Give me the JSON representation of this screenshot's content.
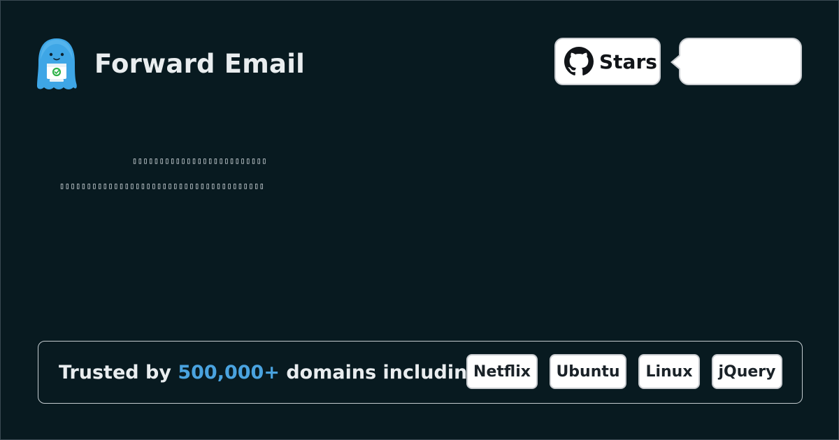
{
  "brand": {
    "name": "Forward Email",
    "logo_icon": "mascot-icon"
  },
  "github": {
    "icon": "github-icon",
    "label": "Stars",
    "count": ""
  },
  "placeholder_lines": [
    "▯▯▯▯▯▯▯▯▯▯▯▯▯▯▯▯▯▯▯▯▯▯▯▯▯",
    "▯▯▯▯▯▯▯▯▯▯▯▯▯▯▯▯▯▯▯▯▯▯▯▯▯▯▯▯▯▯▯▯▯▯▯▯▯▯"
  ],
  "trusted": {
    "prefix": "Trusted by",
    "count": "500,000+",
    "suffix": "domains including:",
    "domains": [
      "Netflix",
      "Ubuntu",
      "Linux",
      "jQuery"
    ]
  },
  "colors": {
    "background": "#081a20",
    "accent": "#4aa3df",
    "text": "#e9edef"
  }
}
